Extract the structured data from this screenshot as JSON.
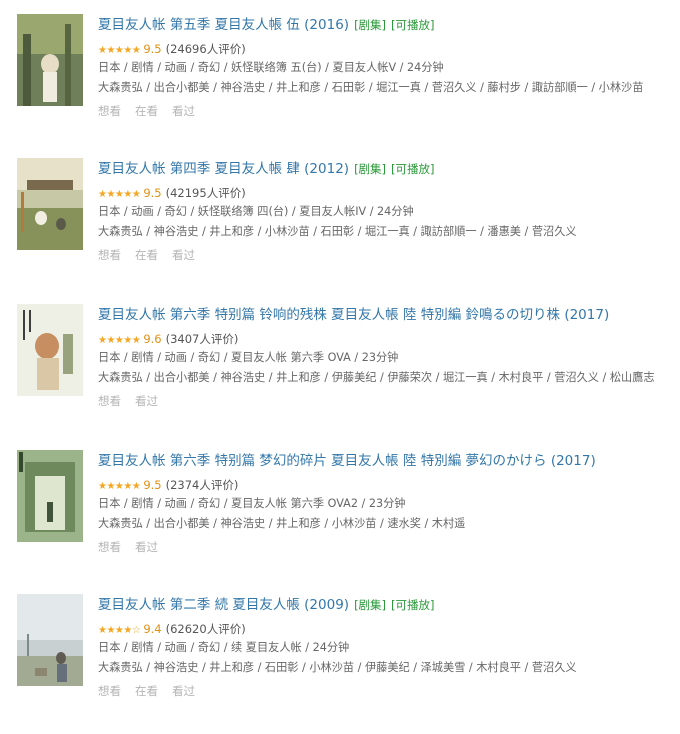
{
  "items": [
    {
      "title": "夏目友人帐 第五季 夏目友人帳 伍 (2016)",
      "tags": [
        "[剧集]",
        "[可播放]"
      ],
      "stars": "★★★★★",
      "score": "9.5",
      "count": "(24696人评价)",
      "meta1": "日本 / 剧情 / 动画 / 奇幻 / 妖怪联络簿 五(台) / 夏目友人帐Ⅴ / 24分钟",
      "meta2": "大森贵弘 / 出合小都美 / 神谷浩史 / 井上和彦 / 石田彰 / 堀江一真 / 菅沼久义 / 藤村步 / 諏訪部順一 / 小林沙苗",
      "actions": [
        "想看",
        "在看",
        "看过"
      ]
    },
    {
      "title": "夏目友人帐 第四季 夏目友人帳 肆 (2012)",
      "tags": [
        "[剧集]",
        "[可播放]"
      ],
      "stars": "★★★★★",
      "score": "9.5",
      "count": "(42195人评价)",
      "meta1": "日本 / 动画 / 奇幻 / 妖怪联络簿 四(台) / 夏目友人帐IV / 24分钟",
      "meta2": "大森贵弘 / 神谷浩史 / 井上和彦 / 小林沙苗 / 石田彰 / 堀江一真 / 諏訪部順一 / 潘惠美 / 菅沼久义",
      "actions": [
        "想看",
        "在看",
        "看过"
      ]
    },
    {
      "title": "夏目友人帐 第六季 特别篇 铃响的残株 夏目友人帳 陸 特別編 鈴鳴るの切り株 (2017)",
      "tags": [],
      "stars": "★★★★★",
      "score": "9.6",
      "count": "(3407人评价)",
      "meta1": "日本 / 剧情 / 动画 / 奇幻 / 夏目友人帐 第六季 OVA / 23分钟",
      "meta2": "大森贵弘 / 出合小都美 / 神谷浩史 / 井上和彦 / 伊藤美纪 / 伊藤荣次 / 堀江一真 / 木村良平 / 菅沼久义 / 松山鷹志",
      "actions": [
        "想看",
        "看过"
      ]
    },
    {
      "title": "夏目友人帐 第六季 特别篇 梦幻的碎片 夏目友人帳 陸 特別編 夢幻のかけら (2017)",
      "tags": [],
      "stars": "★★★★★",
      "score": "9.5",
      "count": "(2374人评价)",
      "meta1": "日本 / 剧情 / 动画 / 奇幻 / 夏目友人帐 第六季 OVA2 / 23分钟",
      "meta2": "大森贵弘 / 出合小都美 / 神谷浩史 / 井上和彦 / 小林沙苗 / 速水奖 / 木村遥",
      "actions": [
        "想看",
        "看过"
      ]
    },
    {
      "title": "夏目友人帐 第二季 続 夏目友人帳 (2009)",
      "tags": [
        "[剧集]",
        "[可播放]"
      ],
      "stars": "★★★★☆",
      "score": "9.4",
      "count": "(62620人评价)",
      "meta1": "日本 / 剧情 / 动画 / 奇幻 / 续 夏目友人帐 / 24分钟",
      "meta2": "大森贵弘 / 神谷浩史 / 井上和彦 / 石田彰 / 小林沙苗 / 伊藤美纪 / 泽城美雪 / 木村良平 / 菅沼久义",
      "actions": [
        "想看",
        "在看",
        "看过"
      ]
    }
  ],
  "colors": {
    "title": "#3377aa",
    "tag": "#2a9a3a",
    "star": "#f6a623",
    "action": "#b5b5b5"
  }
}
